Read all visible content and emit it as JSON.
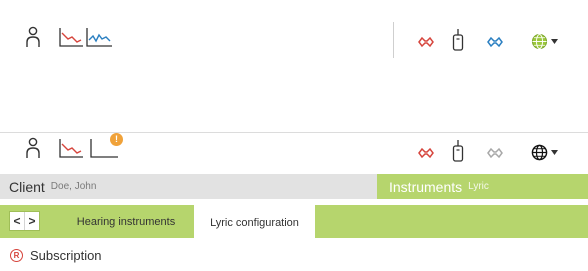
{
  "colors": {
    "accent_green": "#b6d56d",
    "client_gray": "#e2e2e2",
    "left_red": "#d6453d",
    "right_blue": "#2a7fc1",
    "globe_green": "#9bc73b",
    "badge_orange": "#f0a23a"
  },
  "toolbar_top": {
    "icons": [
      "person-icon",
      "audiogram-red-icon",
      "audiogram-blue-icon",
      "left-hearing-aid-icon",
      "remote-device-icon",
      "right-hearing-aid-icon",
      "globe-icon",
      "dropdown-arrow-icon"
    ]
  },
  "toolbar_second": {
    "icons": [
      "person-icon",
      "audiogram-icon",
      "left-hearing-aid-icon",
      "remote-device-icon",
      "right-hearing-aid-icon",
      "globe-icon",
      "dropdown-arrow-icon"
    ],
    "badge": "!"
  },
  "header": {
    "client_label": "Client",
    "client_name": "Doe, John",
    "instruments_label": "Instruments",
    "instruments_sub": "Lyric"
  },
  "tabs": {
    "prev": "<",
    "next": ">",
    "items": [
      {
        "label": "Hearing instruments",
        "active": false
      },
      {
        "label": "Lyric configuration",
        "active": true
      }
    ]
  },
  "subscription": {
    "symbol": "R",
    "label": "Subscription"
  }
}
